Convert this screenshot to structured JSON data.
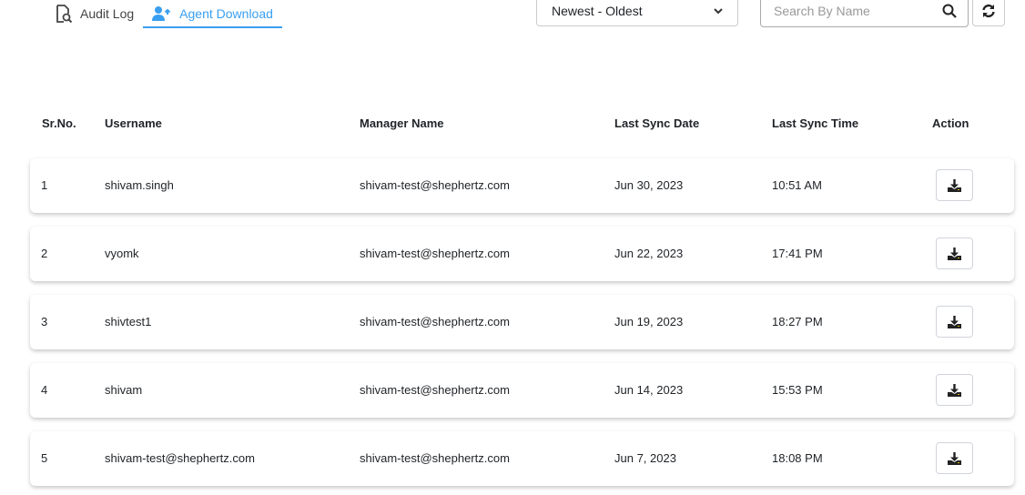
{
  "tabs": [
    {
      "label": "Audit Log",
      "icon": "file-search-icon"
    },
    {
      "label": "Agent Download",
      "icon": "user-upload-icon",
      "active": true
    }
  ],
  "sort": {
    "selected": "Newest - Oldest"
  },
  "search": {
    "placeholder": "Search By Name",
    "value": ""
  },
  "colors": {
    "accent": "#3a9ff0",
    "text": "#212529"
  },
  "table": {
    "headers": [
      "Sr.No.",
      "Username",
      "Manager Name",
      "Last Sync Date",
      "Last Sync Time",
      "Action"
    ],
    "rows": [
      [
        "1",
        "shivam.singh",
        "shivam-test@shephertz.com",
        "Jun 30, 2023",
        "10:51 AM"
      ],
      [
        "2",
        "vyomk",
        "shivam-test@shephertz.com",
        "Jun 22, 2023",
        "17:41 PM"
      ],
      [
        "3",
        "shivtest1",
        "shivam-test@shephertz.com",
        "Jun 19, 2023",
        "18:27 PM"
      ],
      [
        "4",
        "shivam",
        "shivam-test@shephertz.com",
        "Jun 14, 2023",
        "15:53 PM"
      ],
      [
        "5",
        "shivam-test@shephertz.com",
        "shivam-test@shephertz.com",
        "Jun 7, 2023",
        "18:08 PM"
      ]
    ]
  }
}
